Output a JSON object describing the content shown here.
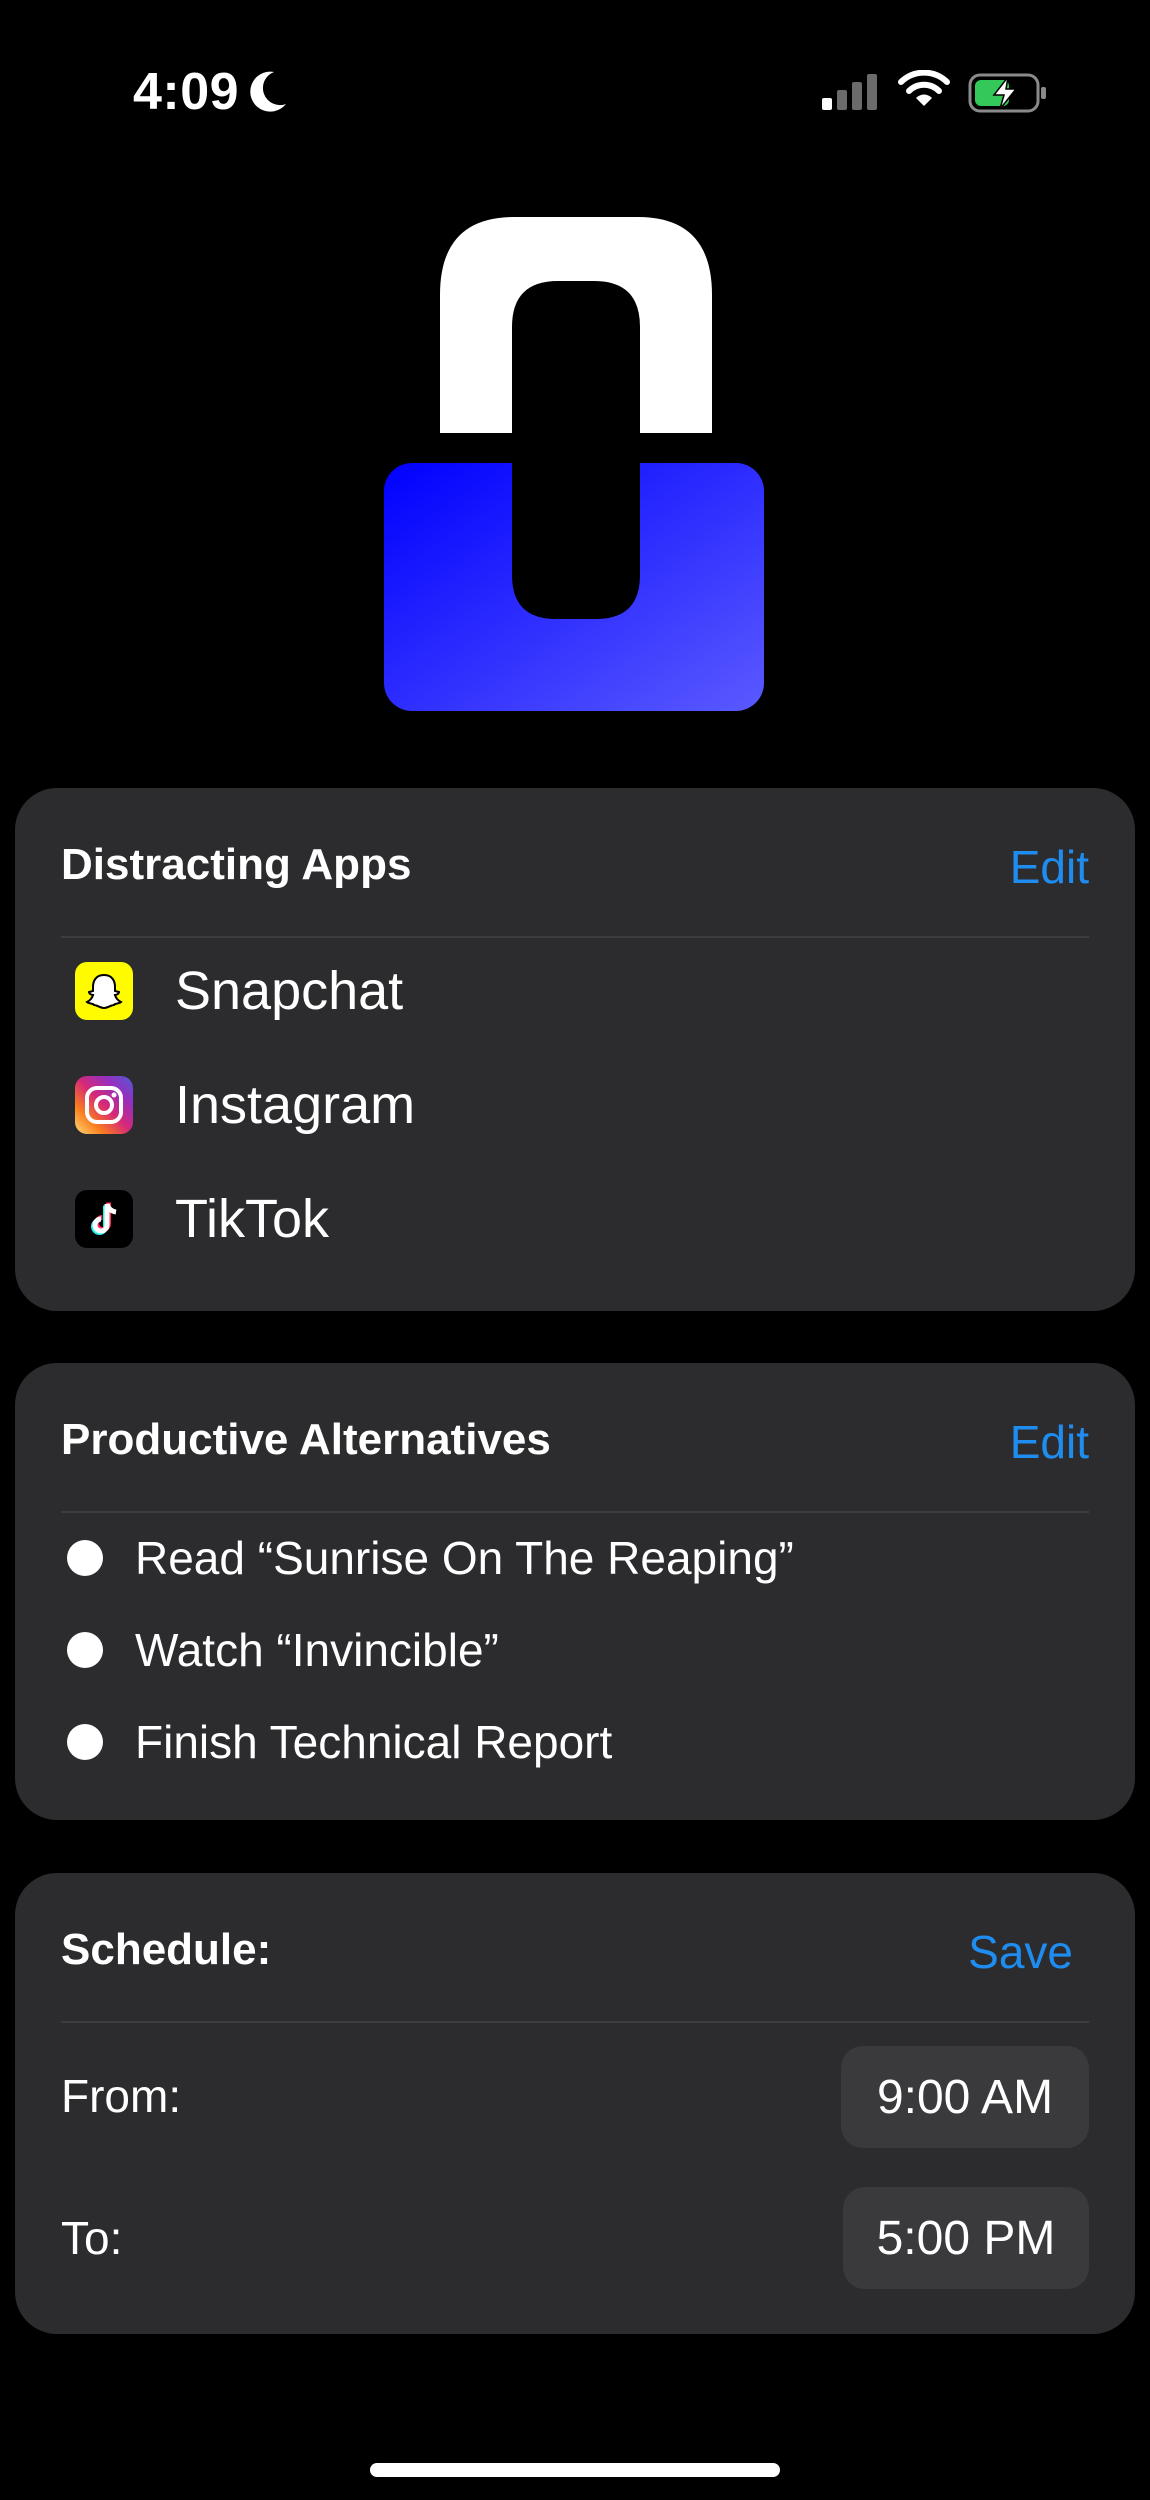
{
  "status_bar": {
    "time": "4:09",
    "focus_icon": "moon-icon",
    "signal_icon": "cellular-signal-icon",
    "wifi_icon": "wifi-icon",
    "battery_icon": "battery-charging-icon"
  },
  "hero": {
    "icon": "lock-icon",
    "gradient_colors": [
      "#0000ff",
      "#5a5aff"
    ]
  },
  "distracting_apps": {
    "title": "Distracting Apps",
    "edit_label": "Edit",
    "apps": [
      {
        "name": "Snapchat",
        "icon": "snapchat-icon"
      },
      {
        "name": "Instagram",
        "icon": "instagram-icon"
      },
      {
        "name": "TikTok",
        "icon": "tiktok-icon"
      }
    ]
  },
  "productive_alternatives": {
    "title": "Productive Alternatives",
    "edit_label": "Edit",
    "items": [
      {
        "text": "Read “Sunrise On The Reaping”"
      },
      {
        "text": "Watch “Invincible”"
      },
      {
        "text": "Finish Technical Report"
      }
    ]
  },
  "schedule": {
    "title": "Schedule:",
    "save_label": "Save",
    "from_label": "From:",
    "from_value": "9:00 AM",
    "to_label": "To:",
    "to_value": "5:00 PM"
  },
  "colors": {
    "accent": "#1f8cf0",
    "card": "#2c2c2e",
    "background": "#000000"
  }
}
